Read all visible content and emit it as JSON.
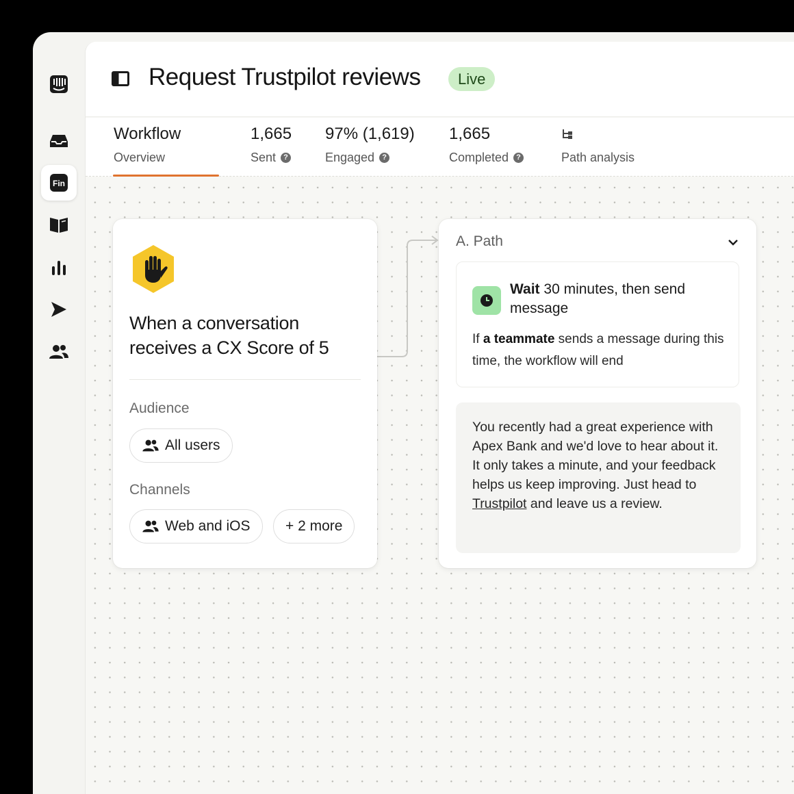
{
  "header": {
    "title": "Request Trustpilot reviews",
    "status_badge": "Live"
  },
  "stats": {
    "workflow": {
      "value": "Workflow",
      "label": "Overview"
    },
    "sent": {
      "value": "1,665",
      "label": "Sent"
    },
    "engaged": {
      "value": "97% (1,619)",
      "label": "Engaged"
    },
    "completed": {
      "value": "1,665",
      "label": "Completed"
    },
    "path_analysis": {
      "label": "Path analysis"
    }
  },
  "trigger": {
    "title": "When a conversation receives a CX Score of 5",
    "audience_label": "Audience",
    "audience_value": "All users",
    "channels_label": "Channels",
    "channels_value": "Web and iOS",
    "channels_more": "+ 2 more"
  },
  "path": {
    "title": "A. Path",
    "wait_bold": "Wait",
    "wait_rest": " 30 minutes, then send message",
    "condition_prefix": "If ",
    "condition_bold": "a teammate",
    "condition_rest": " sends a message during this time, the workflow will end",
    "message_before_link": "You recently had a great experience with Apex Bank and we'd love to hear about it. It only takes a minute, and your feedback helps us keep improving. Just head to ",
    "message_link": "Trustpilot",
    "message_after_link": " and leave us a review."
  },
  "colors": {
    "accent_underline": "#e0732f",
    "live_badge_bg": "#cdeec7",
    "trigger_icon": "#f5c62a",
    "wait_icon_bg": "#9fe3a6"
  },
  "icons": {
    "sidebar": [
      "intercom-logo-icon",
      "inbox-icon",
      "fin-icon",
      "knowledge-book-icon",
      "reports-icon",
      "outbound-icon",
      "contacts-icon"
    ],
    "sidebar_fin_text": "Fin",
    "trigger": "hand-icon",
    "wait": "clock-icon"
  }
}
